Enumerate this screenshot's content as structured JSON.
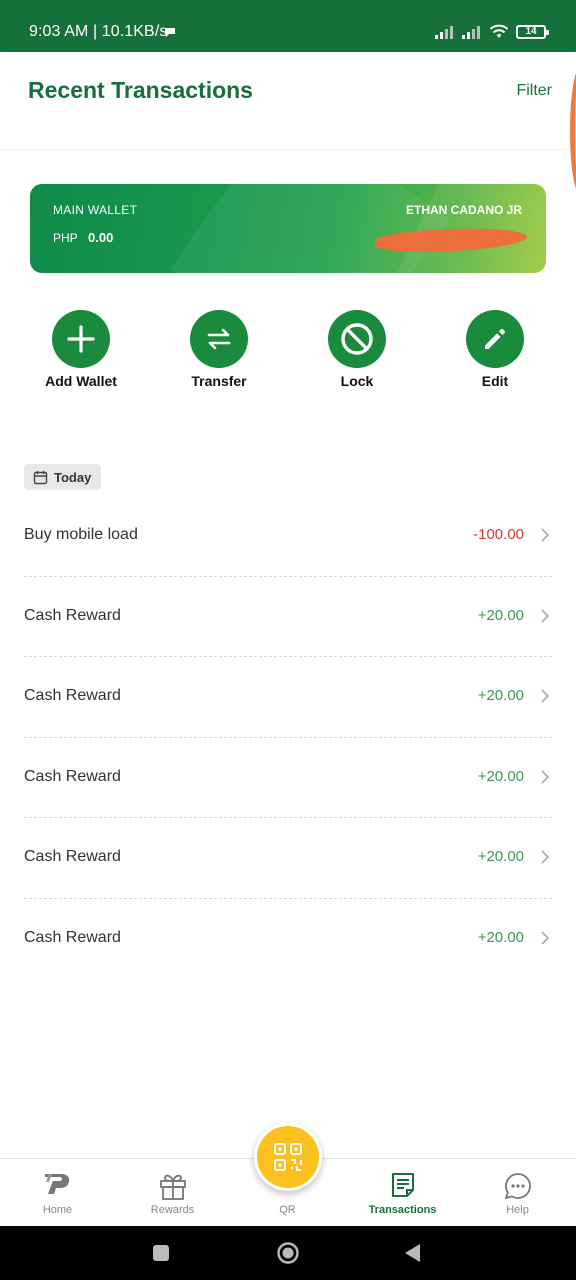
{
  "status_bar": {
    "time_text": "9:03 AM | 10.1KB/s",
    "battery": "14"
  },
  "header": {
    "title": "Recent Transactions",
    "filter_label": "Filter"
  },
  "wallet": {
    "label": "MAIN WALLET",
    "currency": "PHP",
    "balance": "0.00",
    "owner": "ETHAN CADANO JR"
  },
  "actions": [
    {
      "label": "Add Wallet",
      "icon": "plus-icon"
    },
    {
      "label": "Transfer",
      "icon": "transfer-arrows-icon"
    },
    {
      "label": "Lock",
      "icon": "block-icon"
    },
    {
      "label": "Edit",
      "icon": "pencil-icon"
    }
  ],
  "date_group": {
    "label": "Today"
  },
  "transactions": [
    {
      "name": "Buy mobile load",
      "amount": "-100.00"
    },
    {
      "name": "Cash Reward",
      "amount": "+20.00"
    },
    {
      "name": "Cash Reward",
      "amount": "+20.00"
    },
    {
      "name": "Cash Reward",
      "amount": "+20.00"
    },
    {
      "name": "Cash Reward",
      "amount": "+20.00"
    },
    {
      "name": "Cash Reward",
      "amount": "+20.00"
    }
  ],
  "bottom_nav": [
    {
      "label": "Home"
    },
    {
      "label": "Rewards"
    },
    {
      "label": "QR"
    },
    {
      "label": "Transactions"
    },
    {
      "label": "Help"
    }
  ],
  "colors": {
    "brand_green": "#17703b",
    "accent_yellow": "#fbc21f",
    "negative": "#d23b2f",
    "positive": "#3a9a52"
  }
}
